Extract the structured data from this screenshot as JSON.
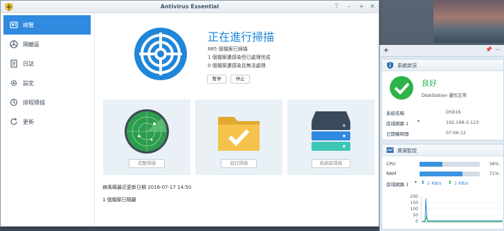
{
  "window": {
    "title": "Antivirus Essential",
    "controls": [
      "pin-icon",
      "minimize-icon",
      "maximize-icon",
      "close-icon"
    ]
  },
  "sidebar": {
    "items": [
      {
        "label": "總覽",
        "icon": "overview-icon",
        "active": true
      },
      {
        "label": "隔離區",
        "icon": "quarantine-icon",
        "active": false
      },
      {
        "label": "日誌",
        "icon": "log-icon",
        "active": false
      },
      {
        "label": "設定",
        "icon": "settings-icon",
        "active": false
      },
      {
        "label": "排程掃描",
        "icon": "schedule-icon",
        "active": false
      },
      {
        "label": "更新",
        "icon": "update-icon",
        "active": false
      }
    ]
  },
  "scan": {
    "title": "正在進行掃描",
    "stats": [
      "885 個檔案已掃描",
      "1 個檔案遭感染但已處理完成",
      "0 個檔案遭感染且無法處理"
    ],
    "pause_label": "暫停",
    "stop_label": "停止"
  },
  "cards": [
    {
      "button": "完整掃描",
      "icon": "radar-icon"
    },
    {
      "button": "自訂掃描",
      "icon": "folder-check-icon"
    },
    {
      "button": "系統區掃描",
      "icon": "server-icon"
    }
  ],
  "footer": {
    "last_update": "病毒碼最近更新日期 2016-07-17 14:50",
    "quarantined": "1 個檔案已隔離"
  },
  "panel": {
    "system_health": {
      "title": "系統狀況",
      "status": "良好",
      "status_desc": "DiskStation 運作正常",
      "rows": [
        {
          "label": "系統名稱",
          "value": "DS916"
        },
        {
          "label": "區域網路 1",
          "value": "192.168.0.123"
        },
        {
          "label": "已開機時間",
          "value": "07:06:12"
        }
      ]
    },
    "resource_monitor": {
      "title": "資源監控",
      "cpu_label": "CPU",
      "cpu_percent": 38,
      "cpu_text": "38%",
      "ram_label": "RAM",
      "ram_percent": 71,
      "ram_text": "71%",
      "lan_label": "區域網路 1",
      "upload": "2 KB/s",
      "download": "1 KB/s",
      "chart_ticks": [
        "200",
        "150",
        "100",
        "50",
        "0"
      ]
    }
  },
  "colors": {
    "accent": "#2f8ae0",
    "good": "#2db34a",
    "card_bg": "#e9f0f6"
  }
}
